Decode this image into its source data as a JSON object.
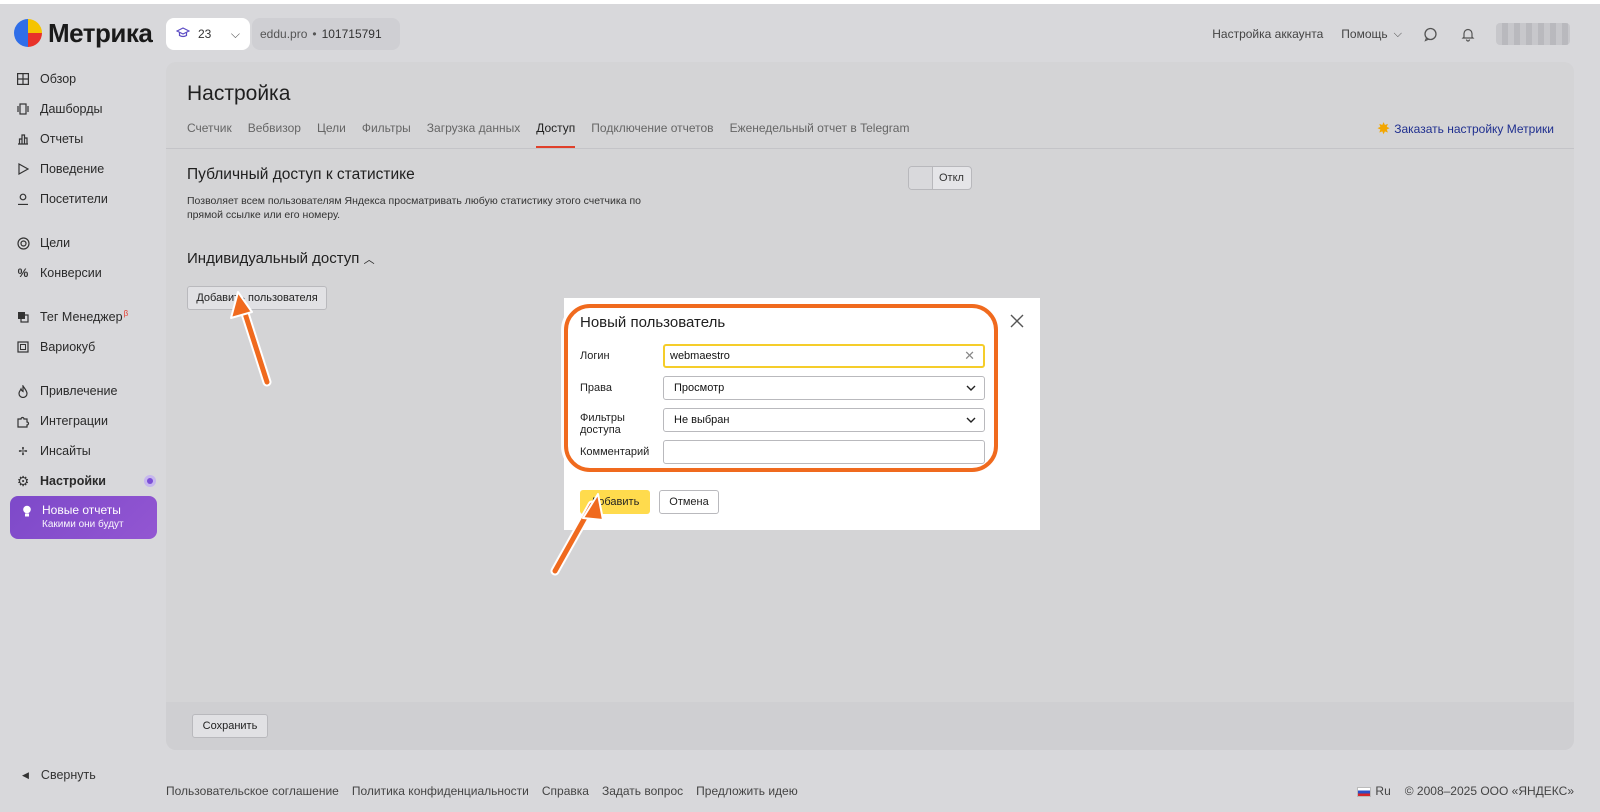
{
  "header": {
    "logo_text": "Метрика",
    "counter": "23",
    "site": "eddu.pro",
    "site_sep": "•",
    "counter_id": "101715791",
    "account_settings": "Настройка аккаунта",
    "help": "Помощь"
  },
  "sidebar": {
    "items": [
      {
        "label": "Обзор",
        "icon": "grid-icon"
      },
      {
        "label": "Дашборды",
        "icon": "dashboard-icon"
      },
      {
        "label": "Отчеты",
        "icon": "bar-chart-icon"
      },
      {
        "label": "Поведение",
        "icon": "play-icon"
      },
      {
        "label": "Посетители",
        "icon": "person-icon"
      },
      {
        "label": "Цели",
        "icon": "target-icon"
      },
      {
        "label": "Конверсии",
        "icon": "percent-icon"
      },
      {
        "label": "Тег Менеджер",
        "icon": "tag-manager-icon",
        "badge": "β"
      },
      {
        "label": "Вариокуб",
        "icon": "variocube-icon"
      },
      {
        "label": "Привлечение",
        "icon": "flame-icon"
      },
      {
        "label": "Интеграции",
        "icon": "puzzle-icon"
      },
      {
        "label": "Инсайты",
        "icon": "sparkle-icon"
      },
      {
        "label": "Настройки",
        "icon": "gear-icon"
      }
    ],
    "promo_title": "Новые отчеты",
    "promo_subtitle": "Какими они будут",
    "collapse": "Свернуть"
  },
  "main": {
    "title": "Настройка",
    "tabs": [
      {
        "label": "Счетчик"
      },
      {
        "label": "Вебвизор"
      },
      {
        "label": "Цели"
      },
      {
        "label": "Фильтры"
      },
      {
        "label": "Загрузка данных"
      },
      {
        "label": "Доступ"
      },
      {
        "label": "Подключение отчетов"
      },
      {
        "label": "Еженедельный отчет в Telegram"
      }
    ],
    "active_tab": "Доступ",
    "order_link": "Заказать настройку Метрики",
    "public_title": "Публичный доступ к статистике",
    "public_desc": "Позволяет всем пользователям Яндекса просматривать любую статистику этого счетчика по прямой ссылке или его номеру.",
    "toggle_label": "Откл",
    "individual_title": "Индивидуальный доступ",
    "add_user_button": "Добавить пользователя",
    "save_button": "Сохранить"
  },
  "modal": {
    "title": "Новый пользователь",
    "login_label": "Логин",
    "login_value": "webmaestro",
    "rights_label": "Права",
    "rights_value": "Просмотр",
    "filters_label": "Фильтры доступа",
    "filters_value": "Не выбран",
    "comment_label": "Комментарий",
    "comment_value": "",
    "add_button": "Добавить",
    "cancel_button": "Отмена"
  },
  "footer": {
    "links": [
      "Пользовательское соглашение",
      "Политика конфиденциальности",
      "Справка",
      "Задать вопрос",
      "Предложить идею"
    ],
    "lang": "Ru",
    "copyright": "© 2008–2025 ООО «ЯНДЕКС»"
  },
  "colors": {
    "accent_yellow": "#ffdb4d",
    "annotation_orange": "#f06a1e",
    "active_tab_underline": "#e0402a",
    "promo_purple": "#7d49c9"
  }
}
